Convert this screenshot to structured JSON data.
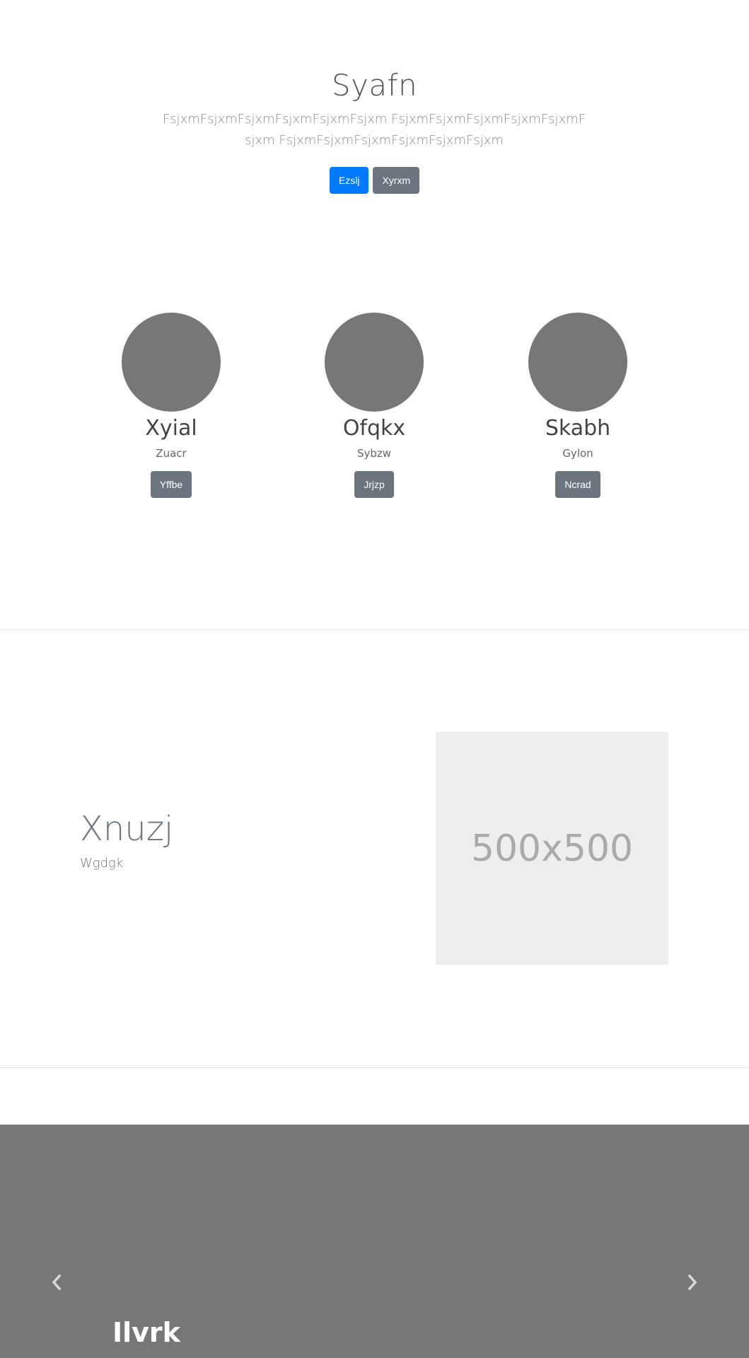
{
  "hero": {
    "title": "Syafn",
    "lead": "FsjxmFsjxmFsjxmFsjxmFsjxmFsjxm FsjxmFsjxmFsjxmFsjxmFsjxmFsjxm FsjxmFsjxmFsjxmFsjxmFsjxmFsjxm",
    "primary_button": "Ezslj",
    "secondary_button": "Xyrxm"
  },
  "trio": [
    {
      "name": "Xyial",
      "sub": "Zuacr",
      "button": "Yffbe"
    },
    {
      "name": "Ofqkx",
      "sub": "Sybzw",
      "button": "Jrjzp"
    },
    {
      "name": "Skabh",
      "sub": "Gylon",
      "button": "Ncrad"
    }
  ],
  "featurette": {
    "heading": "Xnuzj",
    "subheading": "Wgdgk",
    "image_label": "500x500"
  },
  "carousel": {
    "caption_heading": "Ilvrk",
    "prev_icon": "chevron-left-icon",
    "next_icon": "chevron-right-icon"
  },
  "colors": {
    "primary": "#007bff",
    "secondary": "#6c757d",
    "placeholder_gray": "#777777"
  }
}
